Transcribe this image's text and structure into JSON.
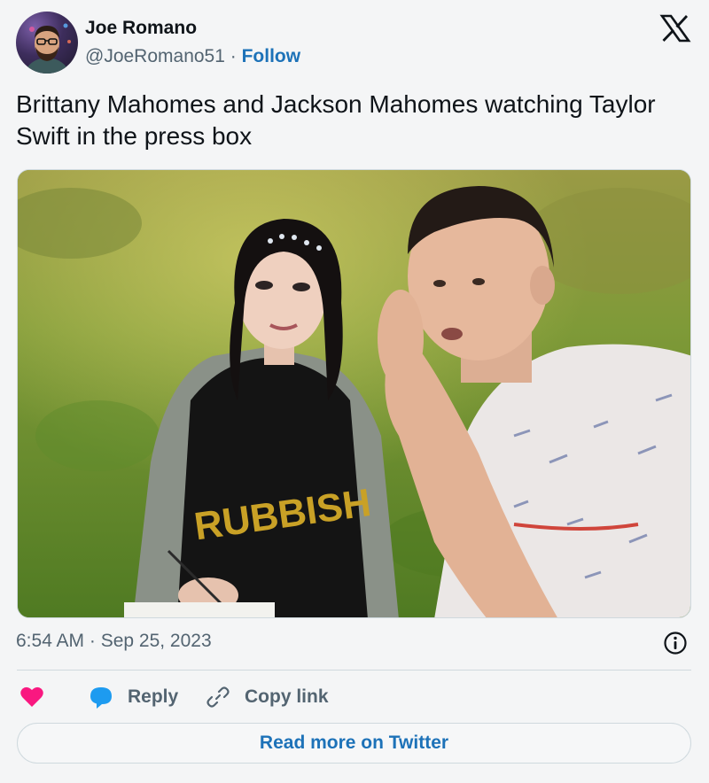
{
  "author": {
    "name": "Joe Romano",
    "handle": "@JoeRomano51",
    "separator": "·",
    "follow_label": "Follow"
  },
  "tweet": {
    "text_line1": "Brittany Mahomes and Jackson Mahomes watching Taylor",
    "text_line2": "Swift in the press box",
    "timestamp": "6:54 AM · Sep 25, 2023"
  },
  "media": {
    "shirt_text": "RUBBISH"
  },
  "actions": {
    "reply_label": "Reply",
    "copy_link_label": "Copy link"
  },
  "footer": {
    "read_more_label": "Read more on Twitter"
  },
  "icons": {
    "brand_logo": "x-logo-icon",
    "like": "heart-icon",
    "reply": "speech-bubble-icon",
    "copy": "link-icon",
    "info": "info-icon"
  },
  "colors": {
    "like": "#f91880",
    "reply": "#1d9bf0",
    "link": "#1d72b8",
    "muted": "#536471"
  }
}
